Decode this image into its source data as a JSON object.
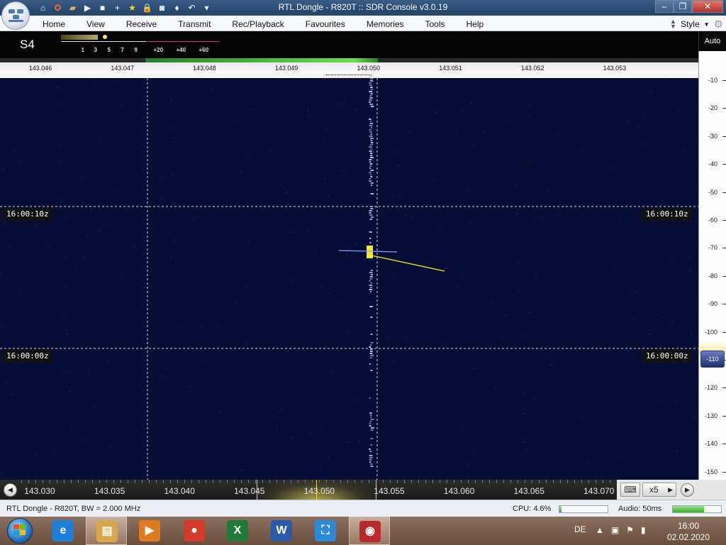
{
  "window": {
    "title": "RTL Dongle - R820T :: SDR Console v3.0.19",
    "quick_access": [
      "home-icon",
      "lifebuoy-icon",
      "folder-icon",
      "play-icon",
      "stop-icon",
      "add-icon",
      "star-icon",
      "lock-icon",
      "camera-icon",
      "drop-icon",
      "undo-icon",
      "dropdown-icon"
    ]
  },
  "menu": {
    "items": [
      "Home",
      "View",
      "Receive",
      "Transmit",
      "Rec/Playback",
      "Favourites",
      "Memories",
      "Tools",
      "Help"
    ],
    "style_label": "Style"
  },
  "smeter": {
    "reading": "S4",
    "scale": [
      "1",
      "3",
      "5",
      "7",
      "9",
      "+20",
      "+40",
      "+60"
    ]
  },
  "auto_label": "Auto",
  "top_ruler": {
    "labels": [
      "143.046",
      "143.047",
      "143.048",
      "143.049",
      "143.050",
      "143.051",
      "143.052",
      "143.053"
    ]
  },
  "waterfall": {
    "timestamps": [
      "16:00:10z",
      "16:00:00z"
    ],
    "colors": {
      "background": "#070d34",
      "signal": "#f2ea28",
      "trace": "#b7c3ff"
    }
  },
  "db_scale": {
    "labels": [
      "-10",
      "-20",
      "-30",
      "-40",
      "-50",
      "-60",
      "-70",
      "-80",
      "-90",
      "-100",
      "-110",
      "-120",
      "-130",
      "-140",
      "-150"
    ],
    "selected": "-110"
  },
  "bottom_strip": {
    "labels": [
      "143.030",
      "143.035",
      "143.040",
      "143.045",
      "143.050",
      "143.055",
      "143.060",
      "143.065",
      "143.070"
    ],
    "zoom_label": "x5"
  },
  "status": {
    "device": "RTL Dongle - R820T, BW = 2.000 MHz",
    "cpu": "CPU: 4.6%",
    "cpu_fraction": 0.05,
    "audio": "Audio: 50ms",
    "audio_fraction": 0.65
  },
  "taskbar": {
    "apps": [
      {
        "name": "internet-explorer-icon",
        "glyph": "e",
        "color": "#1f7fd8"
      },
      {
        "name": "file-explorer-icon",
        "glyph": "▤",
        "color": "#d8a84a"
      },
      {
        "name": "media-player-icon",
        "glyph": "▶",
        "color": "#e07a1f"
      },
      {
        "name": "chrome-icon",
        "glyph": "●",
        "color": "#d33a2c"
      },
      {
        "name": "excel-icon",
        "glyph": "X",
        "color": "#1f7a3a"
      },
      {
        "name": "word-icon",
        "glyph": "W",
        "color": "#2a5aa8"
      },
      {
        "name": "snipping-tool-icon",
        "glyph": "⛶",
        "color": "#2a8ad8"
      },
      {
        "name": "sdr-console-icon",
        "glyph": "◉",
        "color": "#b8282c"
      }
    ],
    "language": "DE",
    "time": "16:00",
    "date": "02.02.2020"
  }
}
